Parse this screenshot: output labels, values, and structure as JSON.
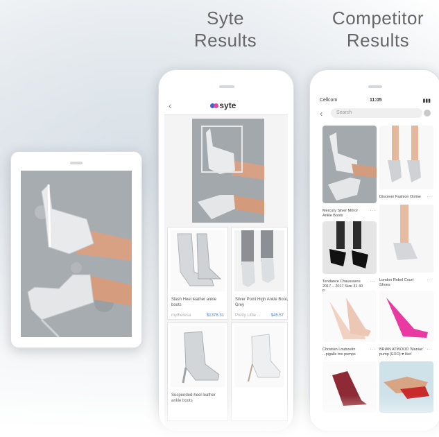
{
  "headings": {
    "syte": [
      "Syte",
      "Results"
    ],
    "competitor": [
      "Competitor",
      "Results"
    ]
  },
  "syte_app": {
    "brand": "syte",
    "results": [
      {
        "title": "Slash Heel leather ankle boots",
        "merchant": "mytheresa",
        "price": "$1378.31"
      },
      {
        "title": "Silver Point High Ankle Boot, Grey",
        "merchant": "Pretty Little ...",
        "price": "$45.57"
      },
      {
        "title": "Suspended-heel leather ankle boots",
        "merchant": "",
        "price": ""
      },
      {
        "title": "",
        "merchant": "",
        "price": ""
      }
    ]
  },
  "competitor_app": {
    "status": {
      "carrier": "Cellcom",
      "time": "11:05"
    },
    "search_placeholder": "Search",
    "pins": [
      {
        "caption": "Mercury Silver Mirror Ankle Boots"
      },
      {
        "caption": "Discover Fashion Online"
      },
      {
        "caption": "Tendance Chaussures 2017 – 2017 Size 31 40 R..."
      },
      {
        "caption": "London Rebel Court Shoes"
      },
      {
        "caption": "Christian Louboutin ...pigalle too pumps"
      },
      {
        "caption": "BRIAN ATWOOD 'Maniac' pump (EXO) ♥ like!"
      },
      {
        "caption": ""
      },
      {
        "caption": ""
      }
    ]
  },
  "colors": {
    "accent_blue": "#3b7ddd",
    "syte_pink": "#e5459a",
    "syte_blue": "#3f63d8"
  }
}
